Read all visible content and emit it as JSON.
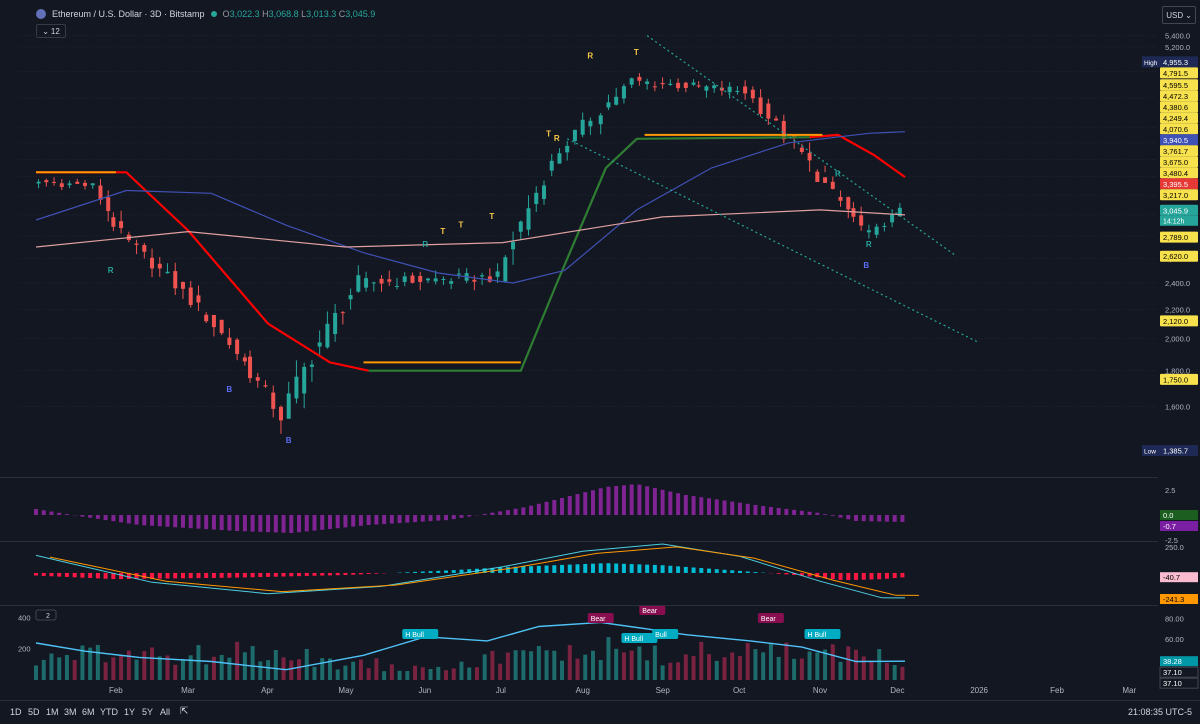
{
  "header": {
    "symbol": "Ethereum / U.S. Dollar · 3D · Bitstamp",
    "o_label": "O",
    "o": "3,022.3",
    "h_label": "H",
    "h": "3,068.8",
    "l_label": "L",
    "l": "3,013.3",
    "c_label": "C",
    "c": "3,045.9",
    "indicator_count": "12",
    "currency": "USD"
  },
  "colors": {
    "background": "#131722",
    "up": "#26a69a",
    "down": "#ef5350",
    "ma_short": "#ff0000",
    "ma_short_bull": "#2e7d32",
    "ma_mid": "#3f51b5",
    "ma_long": "#e0a0a0",
    "sr_line": "#ff9800",
    "histogram": "#9c27b0",
    "tsi_up": "#00bcd4",
    "tsi_down": "#ff1744",
    "vol_up": "#26a69a",
    "vol_down": "#ef5350",
    "rsi_line": "#4fc3f7"
  },
  "chart_data": [
    {
      "type": "candlestick",
      "title": "Ethereum / U.S. Dollar · 3D · Bitstamp",
      "scale": "log",
      "ylim": [
        1300,
        5500
      ],
      "y_ticks": [
        "5,400.0",
        "5,200.0",
        "4,800.0",
        "4,400.0",
        "4,000.0",
        "3,800.0",
        "3,600.0",
        "3,400.0",
        "3,200.0",
        "3,000.0",
        "2,800.0",
        "2,600.0",
        "2,400.0",
        "2,200.0",
        "2,000.0",
        "1,800.0",
        "1,600.0"
      ],
      "x_ticks": [
        "Feb",
        "Mar",
        "Apr",
        "May",
        "Jun",
        "Jul",
        "Aug",
        "Sep",
        "Oct",
        "Nov",
        "Dec",
        "2026",
        "Feb",
        "Mar"
      ],
      "ohlc_ranges": [
        {
          "from": "2025-01-01",
          "to": "2025-01-25",
          "open": 3350,
          "high": 3750,
          "low": 3100,
          "close": 3300
        },
        {
          "from": "2025-01-25",
          "to": "2025-02-05",
          "open": 3300,
          "high": 3400,
          "low": 2150,
          "close": 2800
        },
        {
          "from": "2025-02-05",
          "to": "2025-03-10",
          "open": 2800,
          "high": 2850,
          "low": 2000,
          "close": 2150
        },
        {
          "from": "2025-03-10",
          "to": "2025-04-08",
          "open": 2150,
          "high": 2100,
          "low": 1385.7,
          "close": 1550
        },
        {
          "from": "2025-04-08",
          "to": "2025-05-08",
          "open": 1550,
          "high": 2600,
          "low": 1540,
          "close": 2400
        },
        {
          "from": "2025-05-08",
          "to": "2025-07-01",
          "open": 2400,
          "high": 2880,
          "low": 2150,
          "close": 2450
        },
        {
          "from": "2025-07-01",
          "to": "2025-07-25",
          "open": 2450,
          "high": 3800,
          "low": 2400,
          "close": 3700
        },
        {
          "from": "2025-07-25",
          "to": "2025-08-22",
          "open": 3700,
          "high": 4800,
          "low": 3400,
          "close": 4650
        },
        {
          "from": "2025-08-22",
          "to": "2025-10-05",
          "open": 4650,
          "high": 4955.3,
          "low": 3800,
          "close": 4500
        },
        {
          "from": "2025-10-05",
          "to": "2025-11-05",
          "open": 4500,
          "high": 4955.3,
          "low": 3450,
          "close": 3300
        },
        {
          "from": "2025-11-05",
          "to": "2025-11-22",
          "open": 3300,
          "high": 3600,
          "low": 2650,
          "close": 2800
        },
        {
          "from": "2025-11-22",
          "to": "2025-12-04",
          "open": 2800,
          "high": 3217,
          "low": 2700,
          "close": 3045.9
        }
      ],
      "price_labels": [
        {
          "text": "4,955.3",
          "price": 4955.3,
          "tag": "High",
          "kind": "high"
        },
        {
          "text": "4,791.5",
          "price": 4791.5,
          "kind": "level"
        },
        {
          "text": "4,595.5",
          "price": 4595.5,
          "kind": "level"
        },
        {
          "text": "4,472.3",
          "price": 4472.3,
          "kind": "level"
        },
        {
          "text": "4,380.6",
          "price": 4380.6,
          "kind": "level"
        },
        {
          "text": "4,249.4",
          "price": 4249.4,
          "kind": "level"
        },
        {
          "text": "4,070.6",
          "price": 4070.6,
          "kind": "level"
        },
        {
          "text": "3,940.5",
          "price": 3940.5,
          "kind": "ma_mid"
        },
        {
          "text": "3,761.7",
          "price": 3761.7,
          "kind": "level"
        },
        {
          "text": "3,675.0",
          "price": 3675.0,
          "kind": "level"
        },
        {
          "text": "3,480.4",
          "price": 3480.4,
          "kind": "level"
        },
        {
          "text": "3,395.5",
          "price": 3395.5,
          "kind": "ma_short"
        },
        {
          "text": "3,217.0",
          "price": 3217.0,
          "kind": "level"
        },
        {
          "text": "3,045.9",
          "price": 3045.9,
          "kind": "last"
        },
        {
          "text": "2,789.0",
          "price": 2789.0,
          "kind": "level"
        },
        {
          "text": "2,620.0",
          "price": 2620.0,
          "kind": "level"
        },
        {
          "text": "2,120.0",
          "price": 2120.0,
          "kind": "level"
        },
        {
          "text": "1,750.0",
          "price": 1750.0,
          "kind": "level"
        },
        {
          "text": "1,385.7",
          "price": 1385.7,
          "tag": "Low",
          "kind": "low"
        }
      ],
      "countdown": "14:12h",
      "signals": [
        {
          "text": "R",
          "date": "2025-01-30",
          "price": 2480
        },
        {
          "text": "B",
          "date": "2025-03-17",
          "price": 1680
        },
        {
          "text": "B",
          "date": "2025-04-09",
          "price": 1420
        },
        {
          "text": "R",
          "date": "2025-06-01",
          "price": 2700
        },
        {
          "text": "T",
          "date": "2025-06-08",
          "price": 2820
        },
        {
          "text": "T",
          "date": "2025-06-15",
          "price": 2880
        },
        {
          "text": "T",
          "date": "2025-06-27",
          "price": 2960
        },
        {
          "text": "T",
          "date": "2025-07-19",
          "price": 3880
        },
        {
          "text": "R",
          "date": "2025-07-22",
          "price": 3820
        },
        {
          "text": "R",
          "date": "2025-08-04",
          "price": 5010
        },
        {
          "text": "T",
          "date": "2025-08-22",
          "price": 5070
        },
        {
          "text": "R",
          "date": "2025-11-08",
          "price": 3400
        },
        {
          "text": "R",
          "date": "2025-11-20",
          "price": 2700
        },
        {
          "text": "B",
          "date": "2025-11-19",
          "price": 2520
        }
      ],
      "series": [
        {
          "name": "ma_short",
          "points": [
            [
              "2025-01-01",
              3450
            ],
            [
              "2025-02-05",
              3450
            ],
            [
              "2025-03-01",
              2850
            ],
            [
              "2025-04-01",
              2100
            ],
            [
              "2025-04-25",
              1850
            ],
            [
              "2025-05-10",
              1800
            ],
            [
              "2025-07-08",
              1800
            ],
            [
              "2025-07-22",
              2400
            ],
            [
              "2025-08-10",
              3500
            ],
            [
              "2025-08-22",
              3850
            ],
            [
              "2025-10-28",
              3870
            ],
            [
              "2025-11-08",
              3900
            ],
            [
              "2025-11-22",
              3650
            ],
            [
              "2025-12-04",
              3395.5
            ]
          ]
        },
        {
          "name": "ma_mid",
          "points": [
            [
              "2025-01-01",
              2950
            ],
            [
              "2025-02-05",
              3250
            ],
            [
              "2025-03-10",
              3220
            ],
            [
              "2025-04-08",
              2900
            ],
            [
              "2025-05-08",
              2650
            ],
            [
              "2025-06-06",
              2480
            ],
            [
              "2025-07-05",
              2400
            ],
            [
              "2025-07-25",
              2500
            ],
            [
              "2025-08-22",
              3050
            ],
            [
              "2025-09-20",
              3500
            ],
            [
              "2025-10-20",
              3800
            ],
            [
              "2025-11-20",
              3920
            ],
            [
              "2025-12-04",
              3940.5
            ]
          ]
        },
        {
          "name": "ma_long",
          "points": [
            [
              "2025-01-01",
              2700
            ],
            [
              "2025-03-01",
              2840
            ],
            [
              "2025-05-01",
              2700
            ],
            [
              "2025-07-01",
              2740
            ],
            [
              "2025-09-01",
              2980
            ],
            [
              "2025-11-01",
              3050
            ],
            [
              "2025-12-04",
              3000
            ]
          ]
        },
        {
          "name": "support",
          "points": [
            [
              "2025-01-01",
              3450
            ],
            [
              "2025-02-01",
              3450
            ]
          ]
        },
        {
          "name": "support",
          "points": [
            [
              "2025-05-08",
              1850
            ],
            [
              "2025-07-08",
              1850
            ]
          ]
        },
        {
          "name": "resistance",
          "points": [
            [
              "2025-08-25",
              3900
            ],
            [
              "2025-11-02",
              3900
            ]
          ]
        },
        {
          "name": "channel_upper",
          "points": [
            [
              "2025-08-26",
              5400
            ],
            [
              "2025-12-24",
              2620
            ]
          ]
        },
        {
          "name": "channel_lower",
          "points": [
            [
              "2025-07-26",
              3850
            ],
            [
              "2026-01-01",
              1980
            ]
          ]
        }
      ]
    },
    {
      "type": "bar",
      "ylim": [
        -2.5,
        3.5
      ],
      "y_ticks": [
        "2.5",
        "-2.5"
      ],
      "value_labels": [
        "0.0",
        "-0.7"
      ],
      "values_description": "oscillator histogram",
      "points": [
        [
          "2025-01-01",
          0.6
        ],
        [
          "2025-01-20",
          -0.2
        ],
        [
          "2025-02-10",
          -1.0
        ],
        [
          "2025-03-20",
          -1.6
        ],
        [
          "2025-04-10",
          -1.8
        ],
        [
          "2025-05-10",
          -1.0
        ],
        [
          "2025-06-10",
          -0.5
        ],
        [
          "2025-07-10",
          0.8
        ],
        [
          "2025-08-10",
          2.8
        ],
        [
          "2025-08-22",
          3.1
        ],
        [
          "2025-09-10",
          2.0
        ],
        [
          "2025-10-10",
          0.9
        ],
        [
          "2025-11-01",
          0.2
        ],
        [
          "2025-11-15",
          -0.6
        ],
        [
          "2025-12-04",
          -0.7
        ]
      ]
    },
    {
      "type": "bar",
      "ylim": [
        -300,
        280
      ],
      "y_ticks": [
        "250.0"
      ],
      "value_labels": [
        "-40.7",
        "-241.3"
      ],
      "points": [
        [
          "2025-01-01",
          -25
        ],
        [
          "2025-02-01",
          -60
        ],
        [
          "2025-03-20",
          -45
        ],
        [
          "2025-05-01",
          -20
        ],
        [
          "2025-06-10",
          25
        ],
        [
          "2025-07-01",
          55
        ],
        [
          "2025-08-10",
          95
        ],
        [
          "2025-09-01",
          75
        ],
        [
          "2025-10-01",
          20
        ],
        [
          "2025-10-25",
          -25
        ],
        [
          "2025-11-10",
          -70
        ],
        [
          "2025-11-25",
          -60
        ],
        [
          "2025-12-04",
          -40.7
        ]
      ],
      "line_points": [
        [
          "2025-01-01",
          170
        ],
        [
          "2025-02-15",
          -90
        ],
        [
          "2025-04-01",
          -200
        ],
        [
          "2025-05-15",
          -130
        ],
        [
          "2025-07-01",
          60
        ],
        [
          "2025-08-01",
          210
        ],
        [
          "2025-09-01",
          280
        ],
        [
          "2025-10-01",
          160
        ],
        [
          "2025-11-01",
          -80
        ],
        [
          "2025-11-25",
          -240
        ],
        [
          "2025-12-04",
          -241.3
        ]
      ]
    },
    {
      "type": "bar",
      "ylim": [
        0,
        460
      ],
      "y_ticks": [
        "400",
        "200"
      ],
      "right_ticks": [
        "60.00",
        "80.00"
      ],
      "value_labels": [
        "38.28",
        "37.10",
        "37.10"
      ],
      "badges": [
        {
          "text": "H Bull",
          "date": "2025-05-30",
          "kind": "bull"
        },
        {
          "text": "Bear",
          "date": "2025-08-08",
          "kind": "bear"
        },
        {
          "text": "Bear",
          "date": "2025-08-28",
          "kind": "bear"
        },
        {
          "text": "H Bull",
          "date": "2025-08-23",
          "kind": "bull"
        },
        {
          "text": "Bull",
          "date": "2025-09-02",
          "kind": "bull"
        },
        {
          "text": "Bear",
          "date": "2025-10-13",
          "kind": "bear"
        },
        {
          "text": "H Bull",
          "date": "2025-11-02",
          "kind": "bull"
        }
      ],
      "pane_index": "2",
      "rsi_points": [
        [
          "2025-01-01",
          56
        ],
        [
          "2025-01-20",
          48
        ],
        [
          "2025-02-10",
          42
        ],
        [
          "2025-03-10",
          38
        ],
        [
          "2025-04-08",
          30
        ],
        [
          "2025-05-08",
          44
        ],
        [
          "2025-06-01",
          62
        ],
        [
          "2025-06-25",
          58
        ],
        [
          "2025-07-15",
          72
        ],
        [
          "2025-08-08",
          76
        ],
        [
          "2025-08-25",
          70
        ],
        [
          "2025-09-10",
          64
        ],
        [
          "2025-10-05",
          58
        ],
        [
          "2025-10-25",
          52
        ],
        [
          "2025-11-15",
          38
        ],
        [
          "2025-12-04",
          38.28
        ]
      ],
      "volume_points": [
        [
          "2025-01-01",
          130
        ],
        [
          "2025-02-01",
          170
        ],
        [
          "2025-03-01",
          155
        ],
        [
          "2025-04-01",
          180
        ],
        [
          "2025-05-01",
          110
        ],
        [
          "2025-06-01",
          90
        ],
        [
          "2025-07-01",
          140
        ],
        [
          "2025-08-01",
          210
        ],
        [
          "2025-09-01",
          150
        ],
        [
          "2025-10-01",
          190
        ],
        [
          "2025-11-01",
          170
        ],
        [
          "2025-12-04",
          130
        ]
      ]
    }
  ],
  "timeframes": [
    "1D",
    "5D",
    "1M",
    "3M",
    "6M",
    "YTD",
    "1Y",
    "5Y",
    "All"
  ],
  "clock": "21:08:35 UTC-5"
}
